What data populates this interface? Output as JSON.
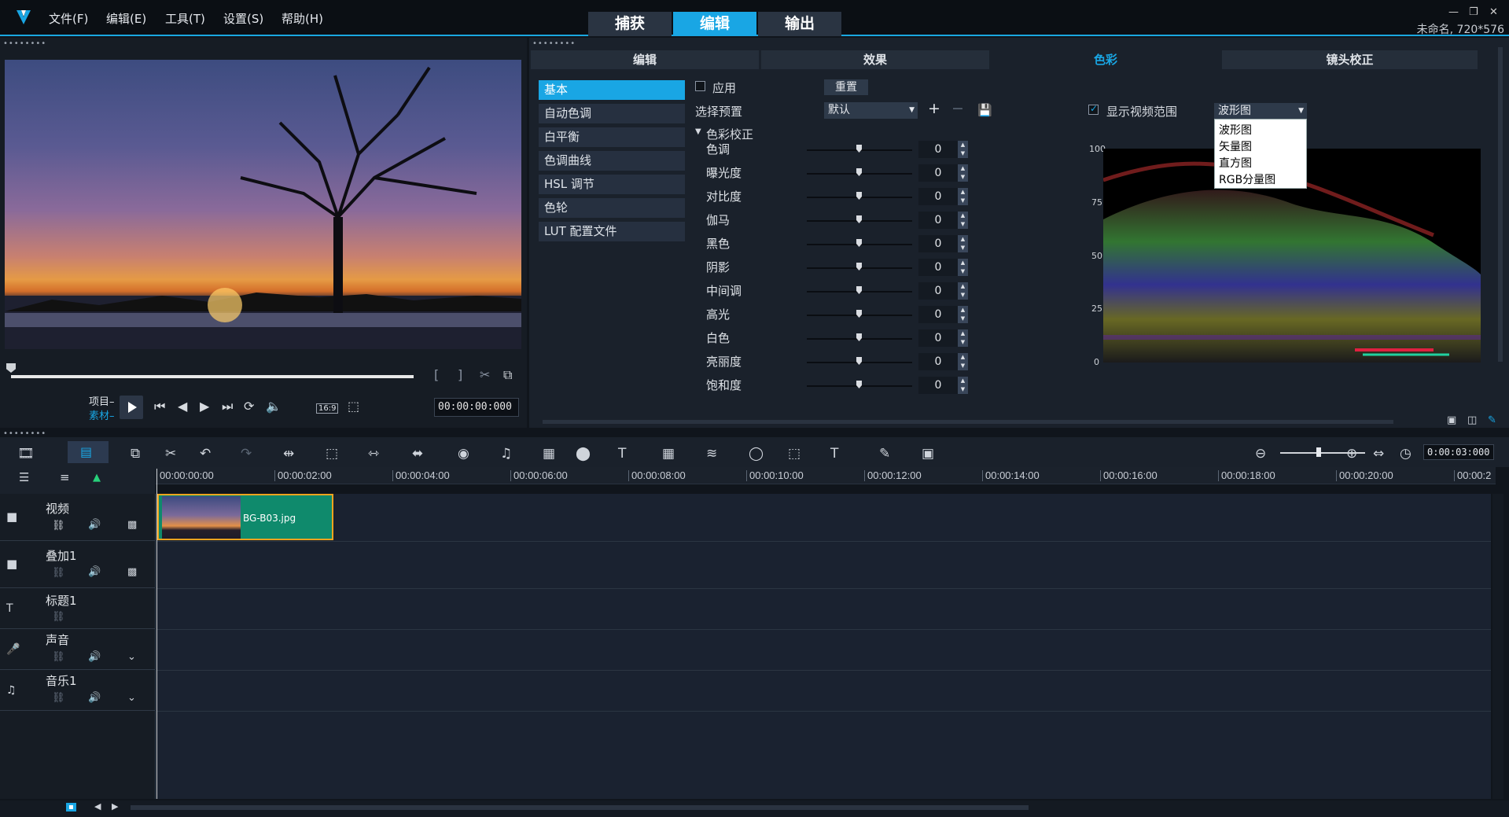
{
  "menubar": {
    "items": [
      "文件(F)",
      "编辑(E)",
      "工具(T)",
      "设置(S)",
      "帮助(H)"
    ],
    "steps": [
      "捕获",
      "编辑",
      "输出"
    ],
    "active_step": "编辑",
    "project_info": "未命名, 720*576"
  },
  "preview": {
    "mode_project": "项目–",
    "mode_clip": "素材–",
    "aspect": "16:9",
    "timecode": "00:00:00:000",
    "bracket_in": "[",
    "bracket_out": "]"
  },
  "panel": {
    "tabs": [
      "编辑",
      "效果",
      "色彩",
      "镜头校正"
    ],
    "active_tab": "色彩",
    "categories": [
      "基本",
      "自动色调",
      "白平衡",
      "色调曲线",
      "HSL 调节",
      "色轮",
      "LUT 配置文件"
    ],
    "active_category": "基本",
    "apply_label": "应用",
    "reset_label": "重置",
    "preset_label": "选择预置",
    "preset_value": "默认",
    "section_label": "色彩校正",
    "sliders": [
      {
        "label": "色调",
        "value": "0"
      },
      {
        "label": "曝光度",
        "value": "0"
      },
      {
        "label": "对比度",
        "value": "0"
      },
      {
        "label": "伽马",
        "value": "0"
      },
      {
        "label": "黑色",
        "value": "0"
      },
      {
        "label": "阴影",
        "value": "0"
      },
      {
        "label": "中间调",
        "value": "0"
      },
      {
        "label": "高光",
        "value": "0"
      },
      {
        "label": "白色",
        "value": "0"
      },
      {
        "label": "亮丽度",
        "value": "0"
      },
      {
        "label": "饱和度",
        "value": "0"
      }
    ],
    "show_scope_label": "显示视频范围",
    "scope_select": "波形图",
    "scope_options": [
      "波形图",
      "矢量图",
      "直方图",
      "RGB分量图"
    ],
    "scope_axis": [
      "100",
      "75",
      "50",
      "25",
      "0"
    ]
  },
  "timeline": {
    "zoom_timecode": "0:00:03:000",
    "ruler": [
      "00:00:00:00",
      "00:00:02:00",
      "00:00:04:00",
      "00:00:06:00",
      "00:00:08:00",
      "00:00:10:00",
      "00:00:12:00",
      "00:00:14:00",
      "00:00:16:00",
      "00:00:18:00",
      "00:00:20:00",
      "00:00:2"
    ],
    "tracks": [
      "视频",
      "叠加1",
      "标题1",
      "声音",
      "音乐1"
    ],
    "clip_name": "BG-B03.jpg"
  },
  "colors": {
    "accent": "#19a6e4",
    "clip": "#0f8a6c",
    "clip_border": "#f2a41e"
  }
}
